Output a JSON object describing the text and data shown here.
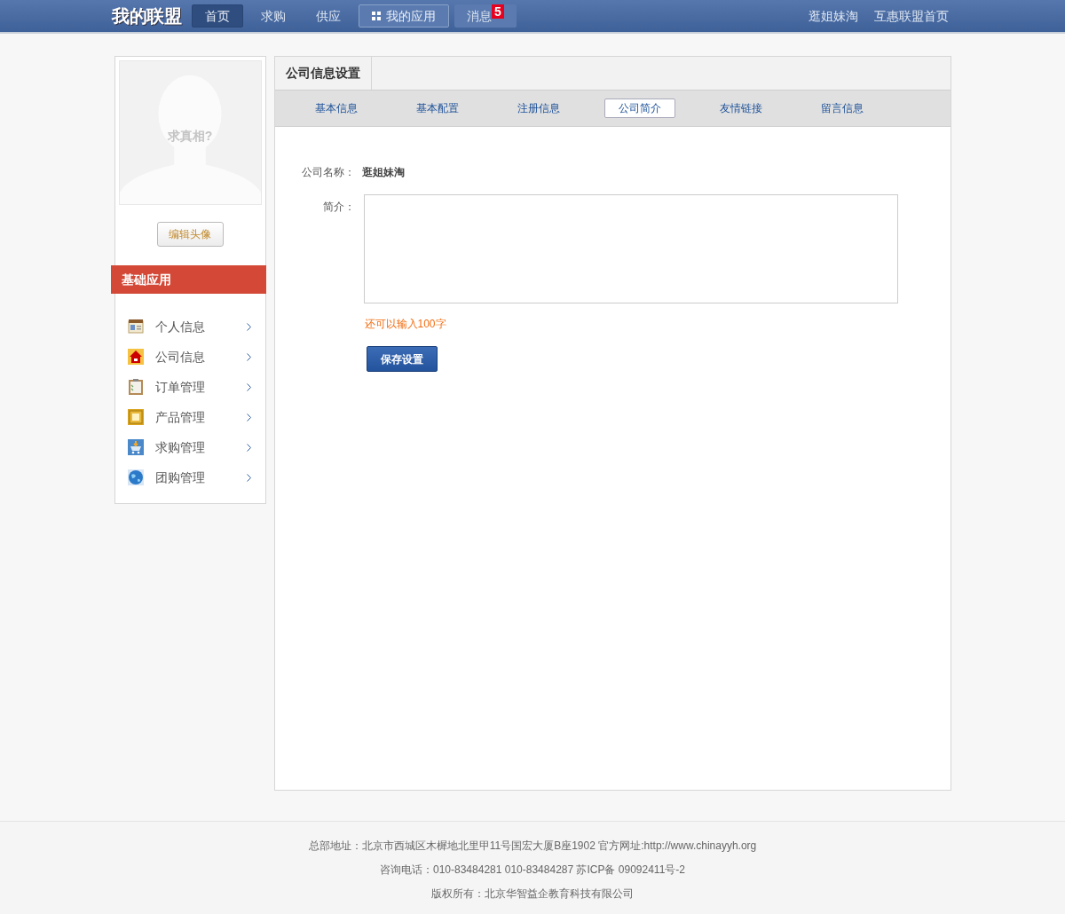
{
  "top_nav": {
    "logo": "我的联盟",
    "items": [
      {
        "label": "首页",
        "kind": "plain",
        "selected": true
      },
      {
        "label": "求购",
        "kind": "plain",
        "selected": false
      },
      {
        "label": "供应",
        "kind": "plain",
        "selected": false
      },
      {
        "label": "我的应用",
        "kind": "apps",
        "selected": false
      },
      {
        "label": "消息",
        "kind": "badge",
        "badge": "5",
        "selected": false
      }
    ],
    "right_links": [
      "逛姐妹淘",
      "互惠联盟首页"
    ]
  },
  "sidebar": {
    "avatar_caption": "求真相?",
    "edit_avatar_button": "编辑头像",
    "section_title": "基础应用",
    "items": [
      {
        "label": "个人信息",
        "kind": "card"
      },
      {
        "label": "公司信息",
        "kind": "house"
      },
      {
        "label": "订单管理",
        "kind": "clipboard"
      },
      {
        "label": "产品管理",
        "kind": "supply"
      },
      {
        "label": "求购管理",
        "kind": "cart"
      },
      {
        "label": "团购管理",
        "kind": "globe"
      }
    ]
  },
  "panel": {
    "title": "公司信息设置",
    "tabs": [
      {
        "label": "基本信息",
        "selected": false
      },
      {
        "label": "基本配置",
        "selected": false
      },
      {
        "label": "注册信息",
        "selected": false
      },
      {
        "label": "公司简介",
        "selected": true
      },
      {
        "label": "友情链接",
        "selected": false
      },
      {
        "label": "留言信息",
        "selected": false
      }
    ],
    "form": {
      "name_label": "公司名称：",
      "name_value": "逛姐妹淘",
      "intro_label": "简介：",
      "hint": "还可以输入100字",
      "save_button": "保存设置"
    }
  },
  "footer": {
    "lines": [
      "总部地址：北京市西城区木樨地北里甲11号国宏大厦B座1902 官方网址:http://www.chinayyh.org",
      "咨询电话：010-83484281 010-83484287 苏ICP备 09092411号-2",
      "版权所有：北京华智益企教育科技有限公司"
    ]
  }
}
